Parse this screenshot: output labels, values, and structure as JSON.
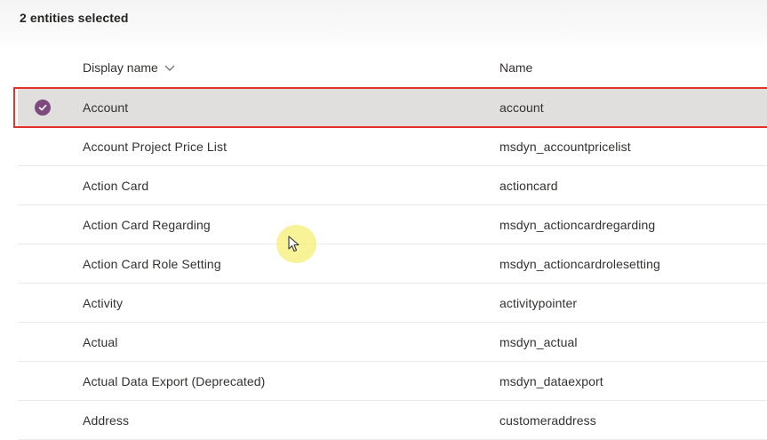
{
  "selection": {
    "count_text": "2 entities selected"
  },
  "grid": {
    "columns": {
      "display_name": "Display name",
      "name": "Name"
    },
    "rows": [
      {
        "display": "Account",
        "name": "account",
        "selected": true
      },
      {
        "display": "Account Project Price List",
        "name": "msdyn_accountpricelist",
        "selected": false
      },
      {
        "display": "Action Card",
        "name": "actioncard",
        "selected": false
      },
      {
        "display": "Action Card Regarding",
        "name": "msdyn_actioncardregarding",
        "selected": false
      },
      {
        "display": "Action Card Role Setting",
        "name": "msdyn_actioncardrolesetting",
        "selected": false
      },
      {
        "display": "Activity",
        "name": "activitypointer",
        "selected": false
      },
      {
        "display": "Actual",
        "name": "msdyn_actual",
        "selected": false
      },
      {
        "display": "Actual Data Export (Deprecated)",
        "name": "msdyn_dataexport",
        "selected": false
      },
      {
        "display": "Address",
        "name": "customeraddress",
        "selected": false
      }
    ]
  },
  "icons": {
    "sort": "chevron-down-icon",
    "check": "checkmark-circle-icon",
    "cursor": "mouse-pointer-icon"
  },
  "colors": {
    "accent": "#7e4a7d",
    "selected_row_bg": "#e1dfdd",
    "highlight_border": "#e3312b",
    "cursor_halo": "#f5ef78"
  }
}
